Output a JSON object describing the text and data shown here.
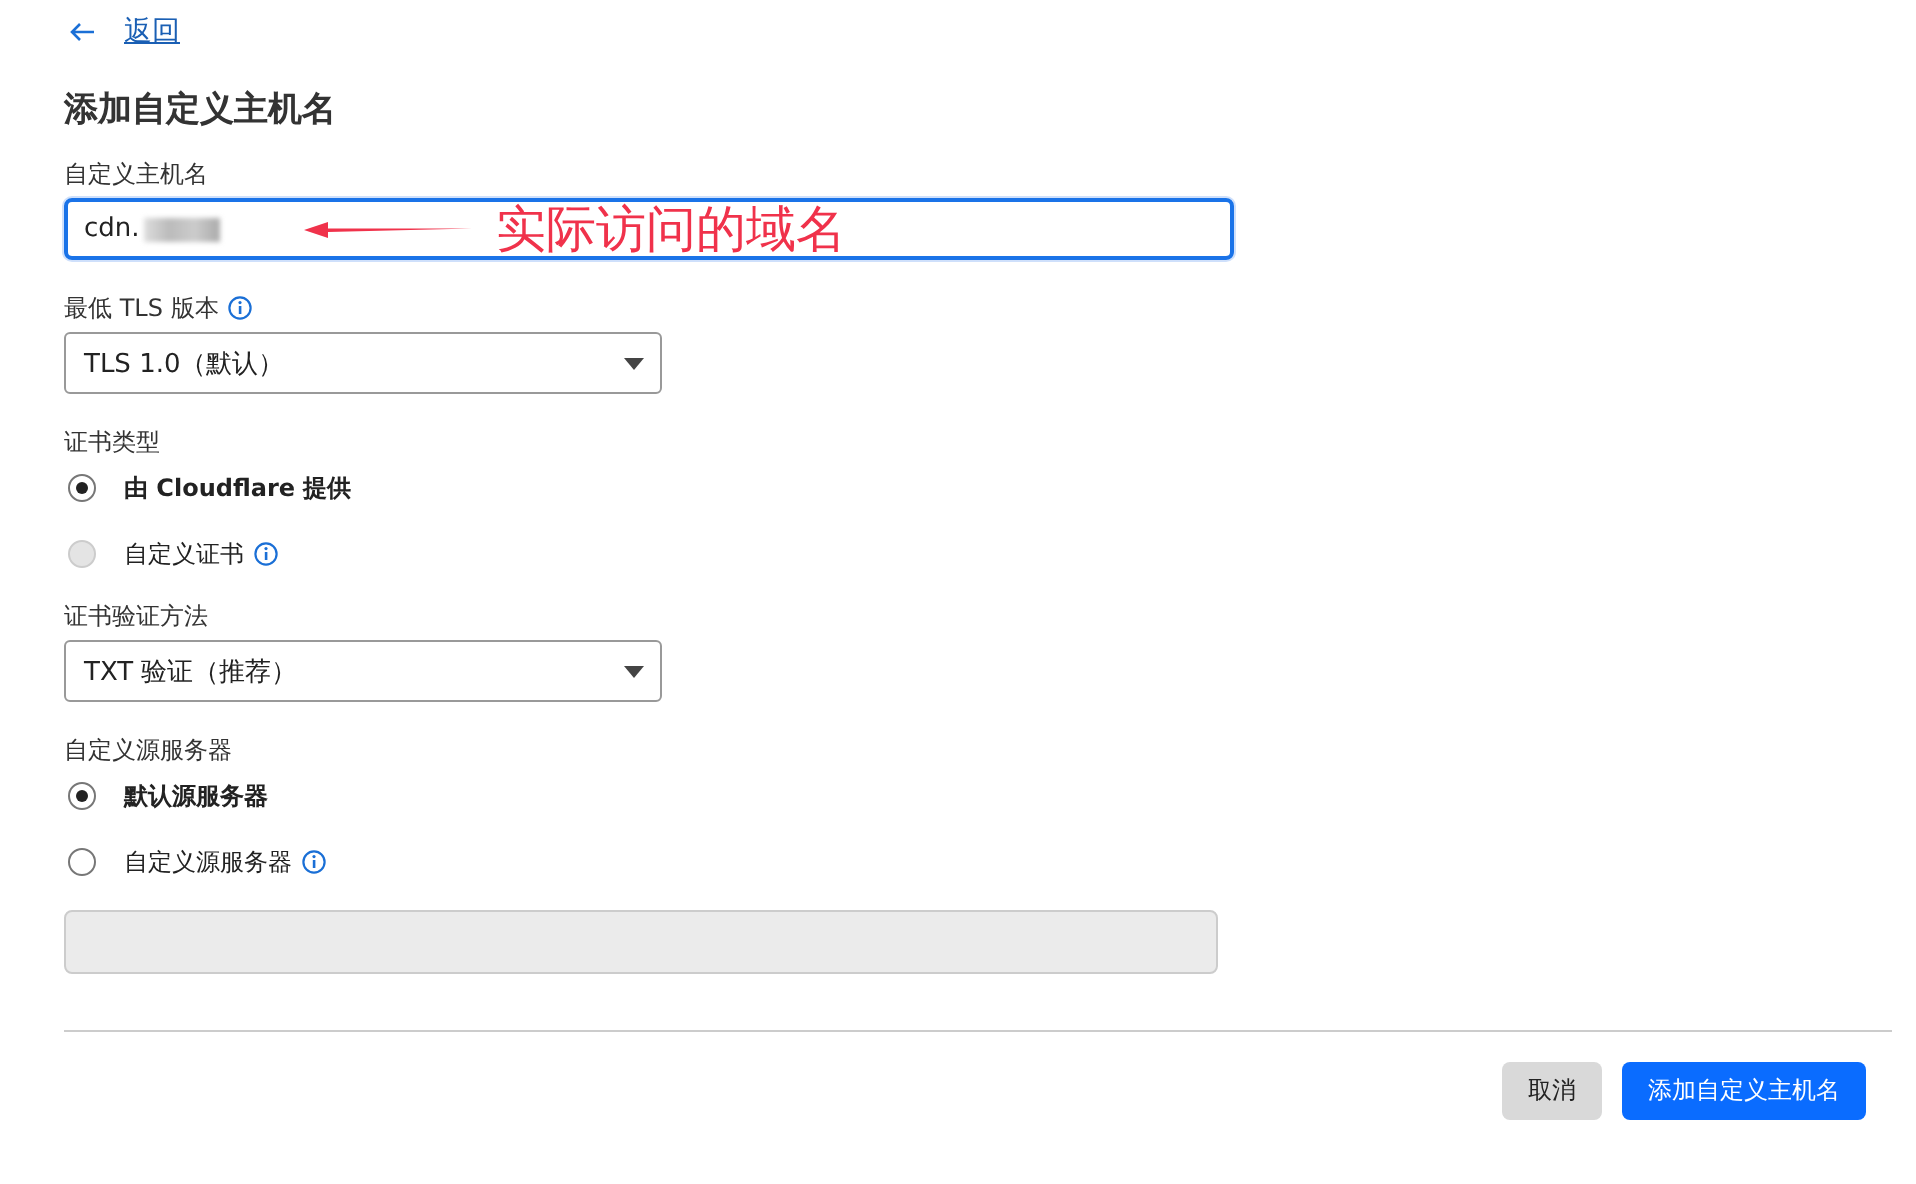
{
  "back_link": {
    "label": "返回"
  },
  "title": "添加自定义主机名",
  "hostname": {
    "label": "自定义主机名",
    "value": "cdn.",
    "redacted": true,
    "focused": true
  },
  "annotation": {
    "text": "实际访问的域名"
  },
  "min_tls": {
    "label": "最低 TLS 版本",
    "info": true,
    "value": "TLS 1.0（默认）"
  },
  "certificate_type": {
    "label": "证书类型",
    "options": [
      {
        "label": "由 Cloudflare 提供",
        "selected": true,
        "disabled": false,
        "info": false
      },
      {
        "label": "自定义证书",
        "selected": false,
        "disabled": true,
        "info": true
      }
    ]
  },
  "validation_method": {
    "label": "证书验证方法",
    "info": false,
    "value": "TXT 验证（推荐）"
  },
  "origin_server": {
    "label": "自定义源服务器",
    "options": [
      {
        "label": "默认源服务器",
        "selected": true,
        "disabled": false,
        "info": false
      },
      {
        "label": "自定义源服务器",
        "selected": false,
        "disabled": false,
        "info": true
      }
    ],
    "field": {
      "disabled": true
    }
  },
  "buttons": [
    {
      "label": "取消",
      "kind": "secondary"
    },
    {
      "label": "添加自定义主机名",
      "kind": "primary"
    }
  ]
}
